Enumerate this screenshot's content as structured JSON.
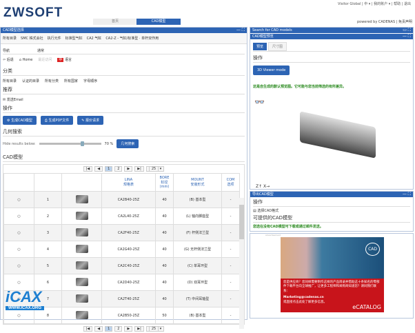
{
  "header": {
    "logo": "ZWSOFT",
    "top_links": "Visitor Global | 中 ▾ | 我的账户 ▾ | 帮助 | 退出",
    "powered": "powered by CADENAS | 免责声明",
    "tabs": [
      "首页",
      "CAD模型"
    ]
  },
  "left": {
    "title": "CAD模型选择",
    "toolbar": [
      "所有目录",
      "SMC 株式会社",
      "执行元件",
      "标准型气缸",
      "CA2 气缸",
      "CA2-Z - 气缸/标准型 · 单杆双作用"
    ],
    "nav_label": "导航",
    "general_label": "通常",
    "nav": [
      "后退",
      "Home",
      "最近访问",
      "语言"
    ],
    "category_label": "分类",
    "categories": [
      "所有目录",
      "认证的目录",
      "所有分类",
      "所有国家",
      "字母顺序"
    ],
    "recommend_label": "推荐",
    "email": "发送Email",
    "ops_label": "操作",
    "ops": [
      "生成CAD模型",
      "生成PDF文件",
      "报价请求"
    ],
    "geo_label": "几何搜索",
    "hide_label": "Hide results below:",
    "hide_value": "70 %",
    "hide_fraction": 0.7,
    "geo_btn": "几何搜索",
    "cad_label": "CAD模型",
    "page_size": "25",
    "pages": [
      "1",
      "2"
    ],
    "columns": [
      "",
      "",
      "",
      "LINA\n规格表",
      "BORE\n缸径\n(mm)",
      "MOUNT\n安装形式",
      "COM\n选项"
    ],
    "rows": [
      [
        "1",
        "CA2B40-25Z",
        "40",
        "(B) 基本型",
        "-"
      ],
      [
        "2",
        "CA2L40-25Z",
        "40",
        "(L) 轴向脚座型",
        "-"
      ],
      [
        "3",
        "CA2F40-25Z",
        "40",
        "(F) 杆侧法兰型",
        "-"
      ],
      [
        "4",
        "CA2G40-25Z",
        "40",
        "(G) 无杆侧法兰型",
        "-"
      ],
      [
        "5",
        "CA2C40-25Z",
        "40",
        "(C) 单耳环型",
        "-"
      ],
      [
        "6",
        "CA2D40-25Z",
        "40",
        "(D) 双耳环型",
        "-"
      ],
      [
        "7",
        "CA2T40-25Z",
        "40",
        "(T) 中间耳轴型",
        "-"
      ],
      [
        "8",
        "CA2B50-25Z",
        "50",
        "(B) 基本型",
        "-"
      ]
    ],
    "watermark": "ICAX WWW.ICAX.ORG"
  },
  "right": {
    "search_title": "Search for CAD models",
    "preview_title": "CAD模型预览",
    "preview_tabs": [
      "预览",
      "尺寸图"
    ],
    "ops_label": "操作",
    "viewer_btn": "3D Viewer mode",
    "notice": "这是自生成的默认预览图。它可能与您当前筛选的有所差异。",
    "export_title": "导出CAD模型",
    "export_ops": "操作",
    "select_format": "选择CAD格式",
    "available": "可提供的CAD模型",
    "export_notice": "您选在没有CAD模型可下载或通过邮件发送。",
    "ad_label": "Advertisement",
    "ad_text": "您是供应商？您同样需要制作这样的产品目录并借助这十条知名的零部件下载平台向全球推广，让更多工程师和采购商知道您？请同我们联系：",
    "ad_email": "Marketing@cadenas.cn",
    "ad_link": "或直接点击此处了解更多信息。",
    "ad_brand": "eCATALOG",
    "ad_logo": "CAD"
  }
}
